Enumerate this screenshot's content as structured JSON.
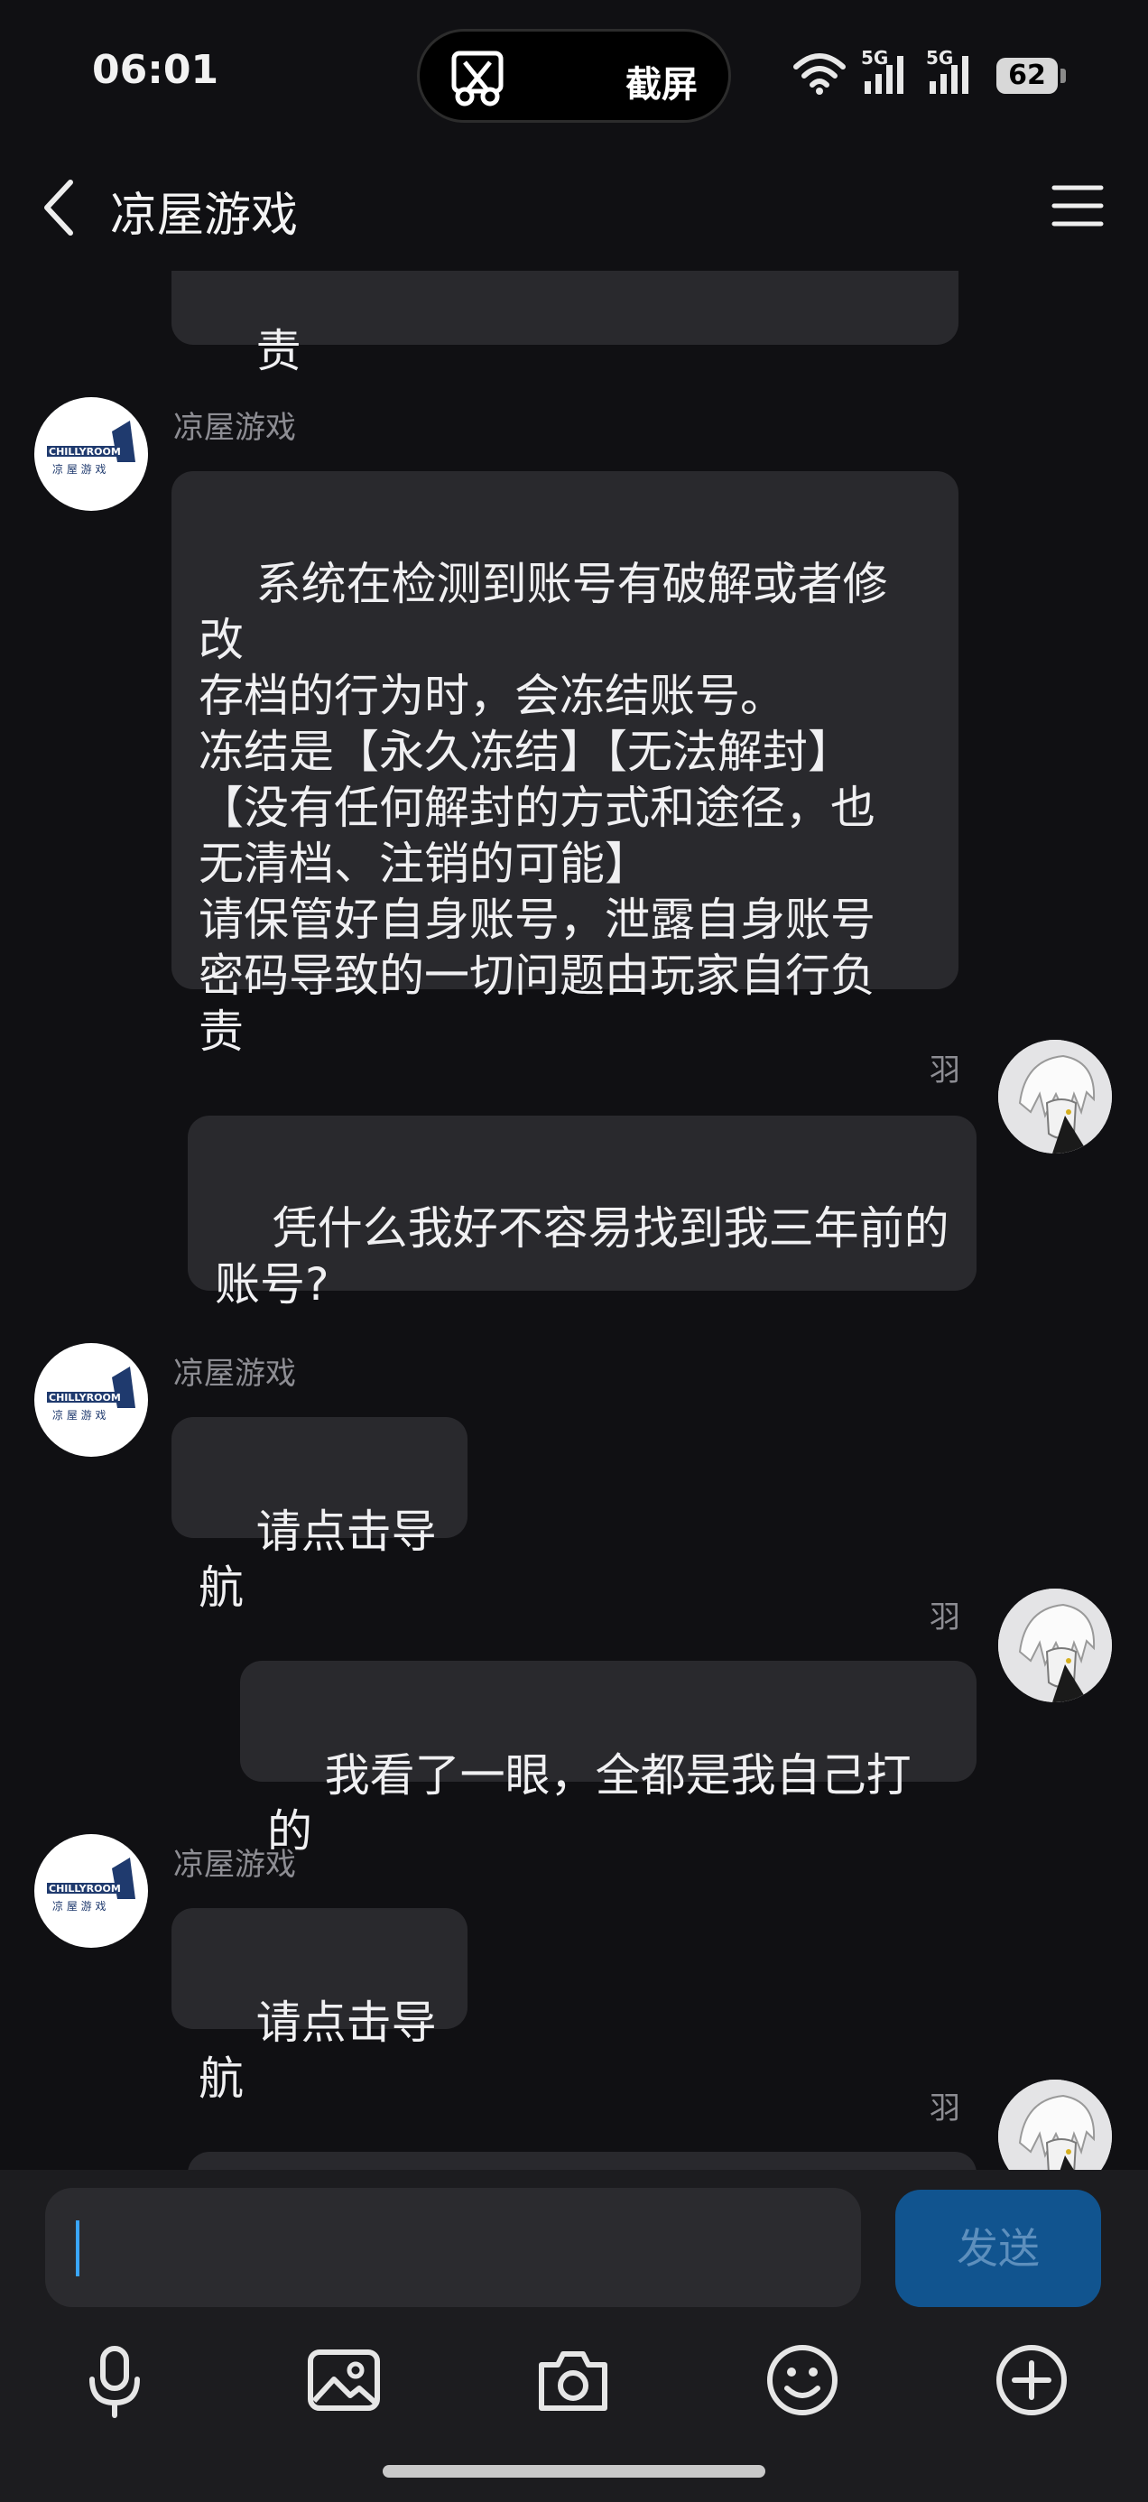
{
  "status_bar": {
    "time": "06:01",
    "pill_label": "截屏",
    "signal_1_label": "5G",
    "signal_2_label": "5G",
    "battery": "62"
  },
  "header": {
    "title": "凉屋游戏"
  },
  "messages": [
    {
      "sender": "",
      "text": "责",
      "side": "left",
      "partial": true
    },
    {
      "sender": "凉屋游戏",
      "text": "系统在检测到账号有破解或者修改\n存档的行为时，会冻结账号。\n冻结是【永久冻结】【无法解封】\n【没有任何解封的方式和途径，也\n无清档、注销的可能】\n请保管好自身账号，泄露自身账号\n密码导致的一切问题由玩家自行负\n责",
      "side": "left"
    },
    {
      "sender": "羽",
      "text": "凭什么我好不容易找到我三年前的\n账号?",
      "side": "right"
    },
    {
      "sender": "凉屋游戏",
      "text": "请点击导航",
      "side": "left"
    },
    {
      "sender": "羽",
      "text": "我看了一眼，全都是我自己打的",
      "side": "right"
    },
    {
      "sender": "凉屋游戏",
      "text": "请点击导航",
      "side": "left"
    },
    {
      "sender": "羽",
      "text": "",
      "side": "right",
      "partial": true
    }
  ],
  "avatars": {
    "bot_logo_top": "CHILLYROOM",
    "bot_logo_bottom": "凉 屋 游 戏"
  },
  "input": {
    "value": "",
    "send_label": "发送"
  },
  "toolbar": [
    "microphone-icon",
    "image-icon",
    "camera-icon",
    "emoji-icon",
    "plus-icon"
  ],
  "colors": {
    "background": "#101013",
    "bubble": "#29292d",
    "send_button": "#11548f",
    "caret": "#3aa6ff"
  }
}
